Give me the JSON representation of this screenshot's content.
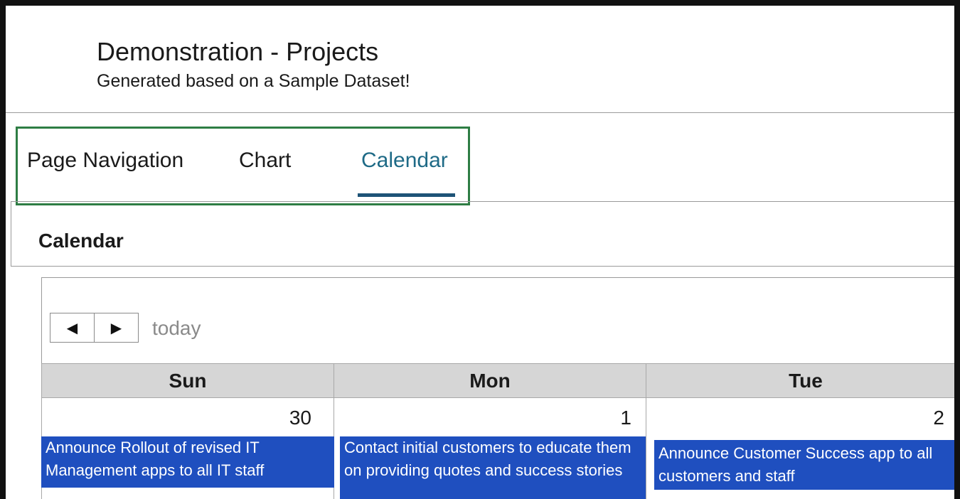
{
  "header": {
    "title": "Demonstration - Projects",
    "subtitle": "Generated based on a Sample Dataset!"
  },
  "tabs": [
    {
      "label": "Page Navigation",
      "active": false
    },
    {
      "label": "Chart",
      "active": false
    },
    {
      "label": "Calendar",
      "active": true
    }
  ],
  "colors": {
    "tab_active": "#1e6a86",
    "tab_underline": "#1e5377",
    "highlight_box": "#2e7d44",
    "event_bg": "#1f4fbf",
    "day_header_bg": "#d6d6d6"
  },
  "calendar": {
    "heading": "Calendar",
    "prev_icon": "triangle-left-icon",
    "next_icon": "triangle-right-icon",
    "prev_glyph": "◀",
    "next_glyph": "▶",
    "today_label": "today",
    "days": [
      {
        "name": "Sun",
        "date": "30"
      },
      {
        "name": "Mon",
        "date": "1"
      },
      {
        "name": "Tue",
        "date": "2"
      }
    ],
    "events": [
      {
        "day": "Sun",
        "text": "Announce Rollout of revised IT Management apps to all IT staff"
      },
      {
        "day": "Mon",
        "text": "Contact initial customers to educate them on providing quotes and success stories"
      },
      {
        "day": "Tue",
        "text": "Announce Customer Success app to all customers and staff"
      }
    ]
  }
}
